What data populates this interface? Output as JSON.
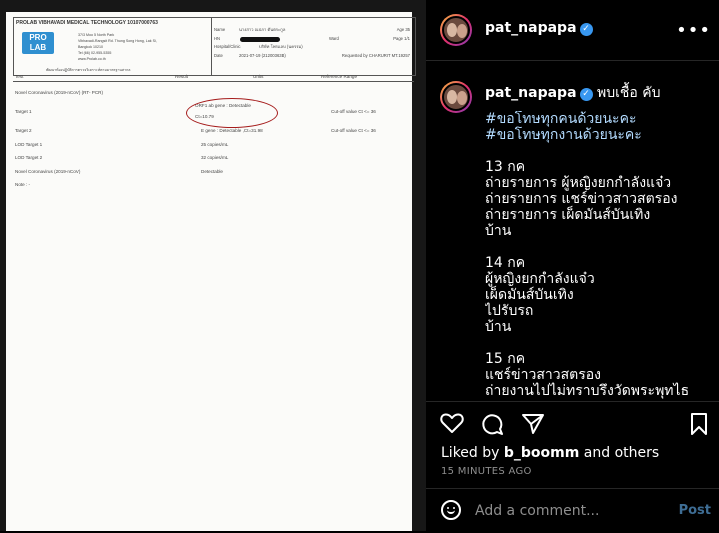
{
  "document": {
    "lab_name": "PROLAB VIBHAVADI MEDICAL TECHNOLOGY 10107000763",
    "logo_line1": "PRO",
    "logo_line2": "LAB",
    "address": [
      "37/3 Moo 5 North Park",
      "Vibhavadi-Rangsit Rd. Thung Song Hong, Lak Si,",
      "Bangkok 10210",
      "Tel (66) 02-955-5355",
      "www.Prolab.co.th"
    ],
    "tagline": "พัฒนาห้องปฏิบัติการตรวจวิเคราะห์ตามมาตรฐานสากล",
    "name_label": "Name",
    "name_value": "นางสาว ณปภา ตันตระกูล",
    "age": "Age 35",
    "hn_label": "HN",
    "ward": "Ward",
    "page": "Page 1/1",
    "hospital_label": "Hospital/Clinic",
    "hospital_value": "บริษัท โพรแลบ (นครรม)",
    "date_label": "Date",
    "date_value": "2021-07-19 (21200363B)",
    "requested": "Requested by CHARURIT MT.19257",
    "columns": [
      "Test",
      "Result",
      "Units",
      "Reference Range"
    ],
    "rows": [
      {
        "test": "Novel Coronavirus (2019-nCoV) (RT- PCR)",
        "result": "",
        "ref": ""
      },
      {
        "test": "Target 1",
        "result": "ORF1 ab gene : Detectable",
        "result2": "Ct=10.79",
        "ref": "Cut-off value Ct <= 36"
      },
      {
        "test": "Target 2",
        "result": "E gene : Detectable ,Ct=31.98",
        "ref": "Cut-off value Ct <= 36"
      },
      {
        "test": "LOD Target 1",
        "result": "25 copies/mL",
        "ref": ""
      },
      {
        "test": "LOD Target 2",
        "result": "32 copies/mL",
        "ref": ""
      },
      {
        "test": "Novel Coronavirus (2019-nCoV)",
        "result": "Detectable",
        "ref": ""
      },
      {
        "test": "Note : -",
        "result": "",
        "ref": ""
      }
    ]
  },
  "header": {
    "username": "pat_napapa",
    "more_label": "•••"
  },
  "caption": {
    "username": "pat_napapa",
    "headline": "พบเชื้อ คับ",
    "lines": [
      "#ขอโทษทุกคนด้วยนะคะ",
      "#ขอโทษทุกงานด้วยนะคะ",
      "",
      "13 กค",
      "ถ่ายรายการ ผู้หญิงยกกำลังแจ๋ว",
      "ถ่ายรายการ แชร์ข่าวสาวสตรอง",
      "ถ่ายรายการ เผ็ดมันส์บันเทิง",
      "บ้าน",
      "",
      "14 กค",
      "ผู้หญิงยกกำลังแจ๋ว",
      "เผ็ดมันส์บันเทิง",
      "ไปรับรถ",
      "บ้าน",
      "",
      "15 กค",
      "แชร์ข่าวสาวสตรอง",
      "ถ่ายงานไปไม่ทราบรึงวัดพระพุทไธ"
    ]
  },
  "footer": {
    "liked_prefix": "Liked by ",
    "liked_user": "b_boomm",
    "liked_suffix": " and others",
    "time_ago": "15 MINUTES AGO",
    "comment_placeholder": "Add a comment...",
    "post_label": "Post"
  },
  "colors": {
    "verified": "#3897f0",
    "hashtag": "#b3dbff",
    "post_button": "#3e6d94",
    "annotation_circle": "#a51c1c"
  },
  "icons": [
    "heart-icon",
    "comment-icon",
    "share-icon",
    "bookmark-icon",
    "emoji-icon",
    "verified-icon",
    "more-icon"
  ]
}
